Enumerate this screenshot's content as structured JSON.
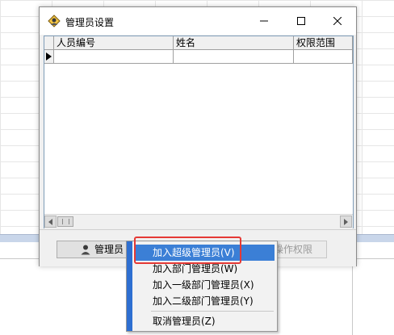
{
  "window": {
    "title": "管理员设置",
    "min_glyph": "—",
    "max_glyph": "☐",
    "close_glyph": "✕"
  },
  "table": {
    "columns": [
      "人员编号",
      "姓名",
      "权限范围"
    ],
    "rows": [
      [
        "",
        "",
        ""
      ]
    ]
  },
  "buttons": {
    "admin": "管理员",
    "operation_permission": "操作权限"
  },
  "context_menu": {
    "items": [
      "加入超级管理员(V)",
      "加入部门管理员(W)",
      "加入一级部门管理员(X)",
      "加入二级部门管理员(Y)",
      "取消管理员(Z)"
    ],
    "selected_index": 0
  },
  "colors": {
    "menu_highlight": "#3b7fd6",
    "menu_strip": "#2e6fd1",
    "annotation_box": "#e53935"
  }
}
